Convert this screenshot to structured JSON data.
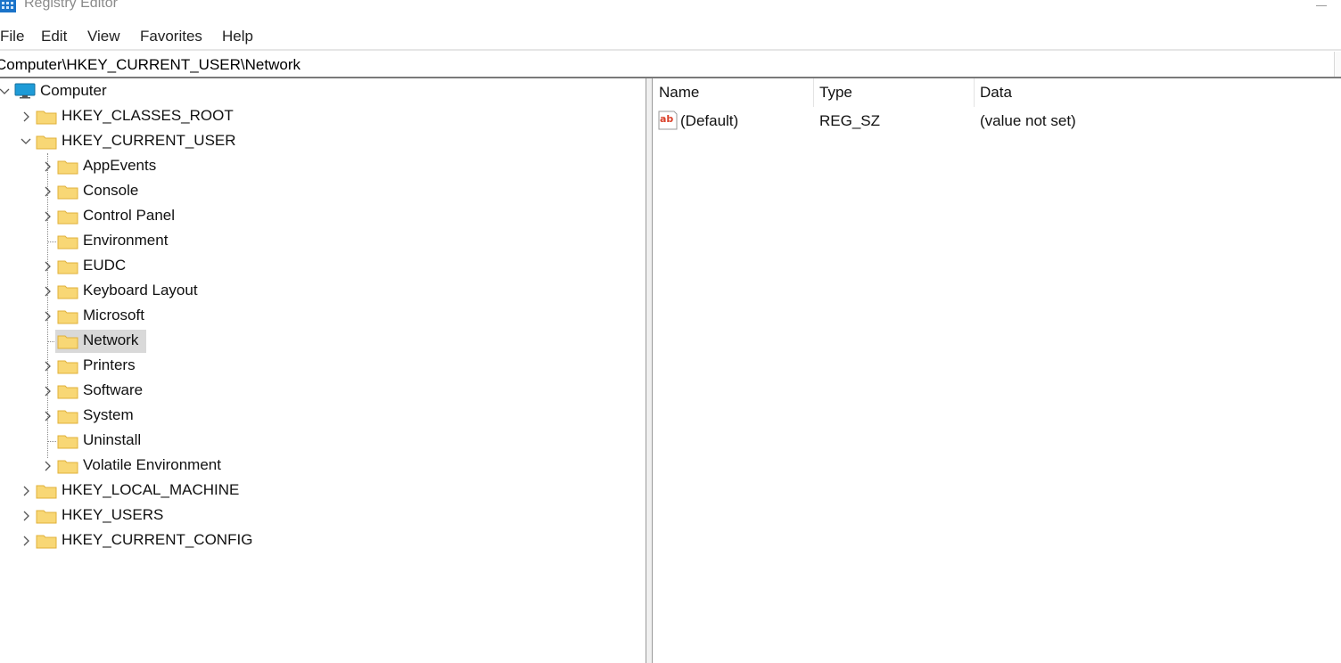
{
  "window": {
    "title": "Registry Editor"
  },
  "menu": [
    "File",
    "Edit",
    "View",
    "Favorites",
    "Help"
  ],
  "address": "Computer\\HKEY_CURRENT_USER\\Network",
  "tree": {
    "root": "Computer",
    "hives": {
      "classes_root": "HKEY_CLASSES_ROOT",
      "current_user": "HKEY_CURRENT_USER",
      "local_machine": "HKEY_LOCAL_MACHINE",
      "users": "HKEY_USERS",
      "current_config": "HKEY_CURRENT_CONFIG"
    },
    "current_user_children": [
      {
        "label": "AppEvents",
        "expandable": true
      },
      {
        "label": "Console",
        "expandable": true
      },
      {
        "label": "Control Panel",
        "expandable": true
      },
      {
        "label": "Environment",
        "expandable": false
      },
      {
        "label": "EUDC",
        "expandable": true
      },
      {
        "label": "Keyboard Layout",
        "expandable": true
      },
      {
        "label": "Microsoft",
        "expandable": true
      },
      {
        "label": "Network",
        "expandable": false,
        "selected": true
      },
      {
        "label": "Printers",
        "expandable": true
      },
      {
        "label": "Software",
        "expandable": true
      },
      {
        "label": "System",
        "expandable": true
      },
      {
        "label": "Uninstall",
        "expandable": false
      },
      {
        "label": "Volatile Environment",
        "expandable": true
      }
    ]
  },
  "values_table": {
    "columns": [
      "Name",
      "Type",
      "Data"
    ],
    "rows": [
      {
        "name": "(Default)",
        "type": "REG_SZ",
        "data": "(value not set)"
      }
    ]
  },
  "colors": {
    "selection": "#d9d9d9",
    "folder": "#f8d775",
    "folder_dark": "#e0b13a",
    "monitor": "#1e9bd7"
  }
}
